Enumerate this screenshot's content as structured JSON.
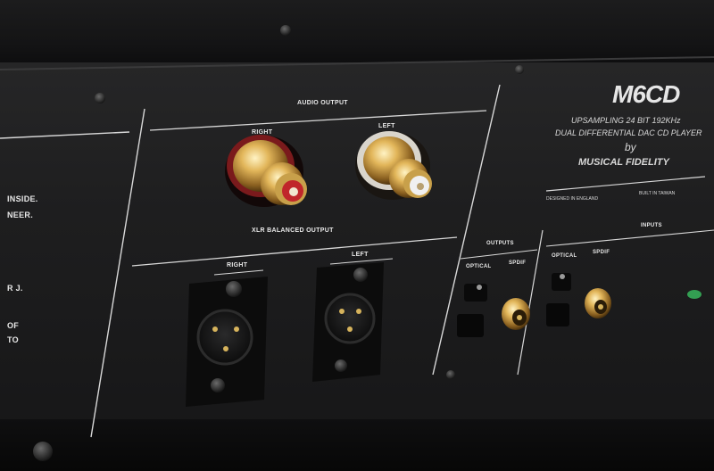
{
  "left_text": [
    "INSIDE.",
    "NEER.",
    "R J.",
    "OF",
    "TO"
  ],
  "audio_output": {
    "title": "AUDIO OUTPUT",
    "right_label": "RIGHT",
    "left_label": "LEFT"
  },
  "xlr_output": {
    "title": "XLR BALANCED OUTPUT",
    "right_label": "RIGHT",
    "left_label": "LEFT"
  },
  "outputs": {
    "title": "OUTPUTS",
    "optical": "OPTICAL",
    "spdif": "SPDIF"
  },
  "inputs": {
    "title": "INPUTS",
    "optical": "OPTICAL",
    "spdif": "SPDIF"
  },
  "brand": {
    "model": "M6CD",
    "line1": "UPSAMPLING 24 BIT 192KHz",
    "line2": "DUAL DIFFERENTIAL DAC CD PLAYER",
    "by": "by",
    "maker": "MUSICAL FIDELITY",
    "designed": "DESIGNED IN ENGLAND",
    "built": "BUILT IN TAIWAN"
  },
  "colors": {
    "panel": "#1e1e1f",
    "gold": "#c8a04a",
    "rca_right_ring": "#c0262b",
    "rca_left_ring": "#e8e8e8"
  }
}
